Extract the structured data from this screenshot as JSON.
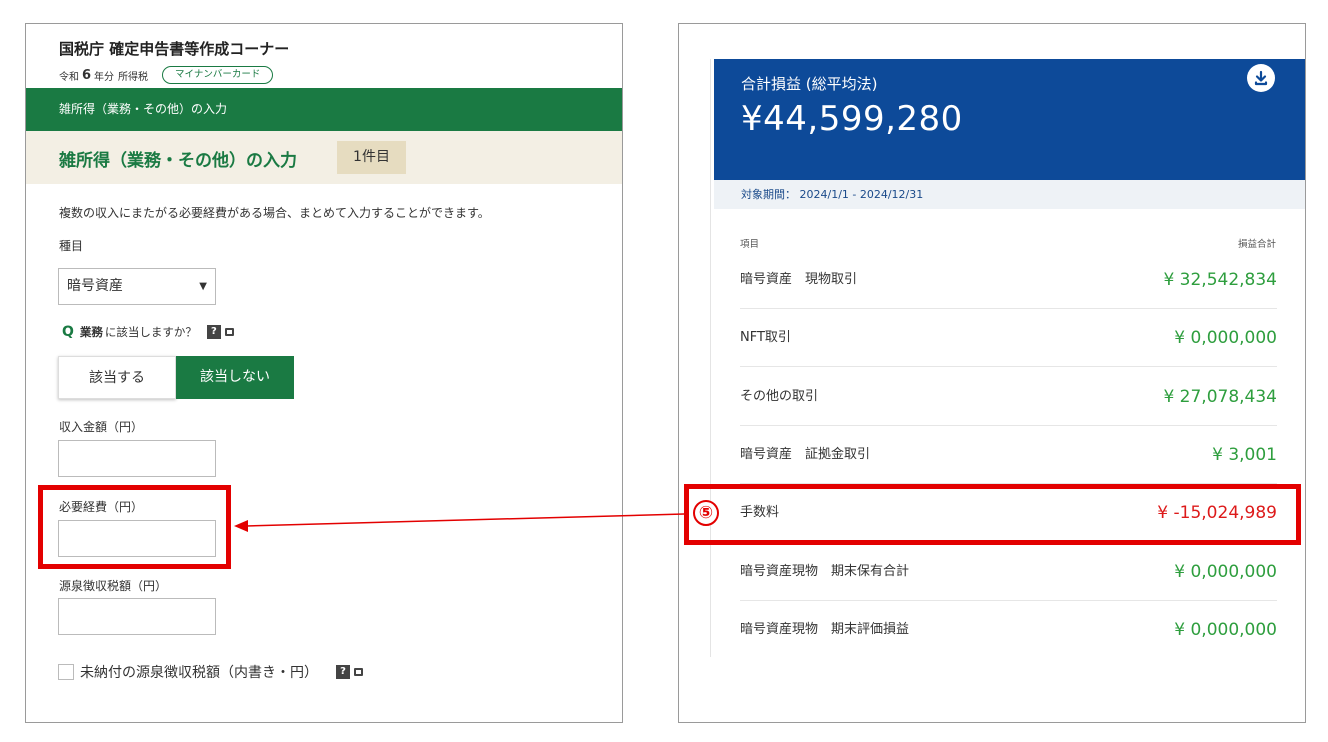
{
  "left": {
    "title": "国税庁 確定申告書等作成コーナー",
    "era": "令和",
    "year": "6",
    "year_suffix": "年分",
    "tax_type": "所得税",
    "pill": "マイナンバーカード",
    "green_bar": "雑所得（業務・その他）の入力",
    "section_title": "雑所得（業務・その他）の入力",
    "count_badge": "1件目",
    "description": "複数の収入にまたがる必要経費がある場合、まとめて入力することができます。",
    "category_label": "種目",
    "category_value": "暗号資産",
    "question_mark": "Q",
    "question_bold": "業務",
    "question_rest": "に該当しますか？",
    "help_glyph": "?",
    "option_yes": "該当する",
    "option_no": "該当しない",
    "income_label": "収入金額（円）",
    "expense_label": "必要経費（円）",
    "withholding_label": "源泉徴収税額（円）",
    "unpaid_label": "未納付の源泉徴収税額（内書き・円）"
  },
  "right": {
    "card_title": "合計損益 (総平均法)",
    "card_amount": "¥44,599,280",
    "period": "対象期間： 2024/1/1 - 2024/12/31",
    "col_item": "項目",
    "col_total": "損益合計",
    "rows": [
      {
        "name": "暗号資産　現物取引",
        "value": "¥ 32,542,834"
      },
      {
        "name": "NFT取引",
        "value": "¥ 0,000,000"
      },
      {
        "name": "その他の取引",
        "value": "¥ 27,078,434"
      },
      {
        "name": "暗号資産　証拠金取引",
        "value": "¥ 3,001"
      },
      {
        "name": "手数料",
        "value": "¥ -15,024,989"
      },
      {
        "name": "暗号資産現物　期末保有合計",
        "value": "¥ 0,000,000"
      },
      {
        "name": "暗号資産現物　期末評価損益",
        "value": "¥ 0,000,000"
      }
    ]
  },
  "annotation": {
    "marker": "⑤",
    "color": "#e30000"
  },
  "colors": {
    "nta_green": "#1a7a43",
    "card_blue": "#0d4a99",
    "positive": "#2e9e3e",
    "negative": "#dd1a1a"
  }
}
